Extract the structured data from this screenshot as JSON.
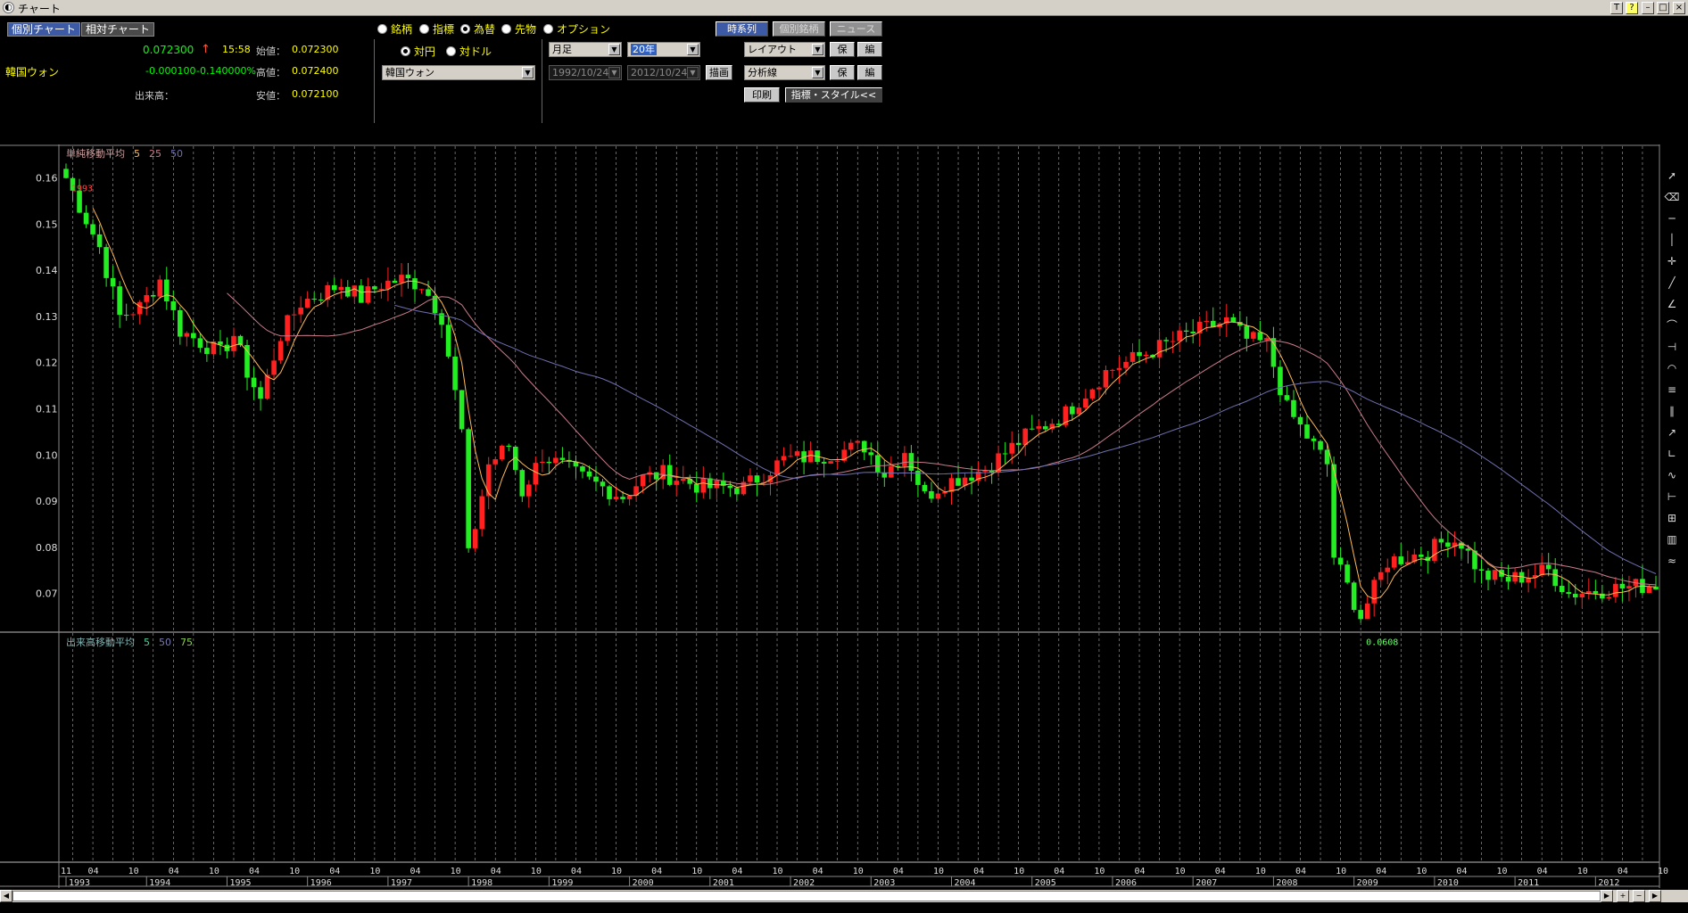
{
  "window": {
    "title": "チャート",
    "buttons": [
      "T",
      "?",
      "–",
      "□",
      "×"
    ]
  },
  "tabs": [
    {
      "label": "個別チャート",
      "active": true
    },
    {
      "label": "相対チャート",
      "active": false
    }
  ],
  "quote": {
    "name": "韓国ウォン",
    "price": "0.072300",
    "arrow": "↑",
    "time": "15:58",
    "change": "-0.000100",
    "change_pct": "-0.140000%",
    "volume_label": "出来高：",
    "open_label": "始値：",
    "open": "0.072300",
    "high_label": "高値：",
    "high": "0.072400",
    "low_label": "安値：",
    "low": "0.072100"
  },
  "instrument_type": {
    "options": [
      "銘柄",
      "指標",
      "為替",
      "先物",
      "オプション"
    ],
    "selected": "為替"
  },
  "base": {
    "options": [
      "対円",
      "対ドル"
    ],
    "selected": "対円"
  },
  "currency_select": "韓国ウォン",
  "period": {
    "interval": "月足",
    "span": "20年",
    "from": "1992/10/24",
    "to": "2012/10/24",
    "draw_label": "描画"
  },
  "buttons": {
    "timeseries": "時系列",
    "stock_info": "個別銘柄",
    "news": "ニュース",
    "layout": "レイアウト",
    "save": "保存",
    "edit": "編集",
    "analysis": "分析線",
    "print": "印刷",
    "indicator_style": "指標・スタイル<<"
  },
  "chart_data": {
    "type": "candlestick",
    "x_unit": "month",
    "start": "1993-01",
    "ylim": [
      0.063,
      0.163
    ],
    "yticks": [
      "0.16",
      "0.15",
      "0.14",
      "0.13",
      "0.12",
      "0.11",
      "0.10",
      "0.09",
      "0.08",
      "0.07"
    ],
    "x_year_labels": [
      "1993",
      "1994",
      "1995",
      "1996",
      "1997",
      "1998",
      "1999",
      "2000",
      "2001",
      "2002",
      "2003",
      "2004",
      "2005",
      "2006",
      "2007",
      "2008",
      "2009",
      "2010",
      "2011",
      "2012"
    ],
    "x_month_labels": [
      "11",
      "04",
      "10"
    ],
    "price_legend": {
      "title": "単純移動平均",
      "periods": [
        "5",
        "25",
        "50"
      ],
      "colors": [
        "#ffbb55",
        "#c97a8a",
        "#6f6fb0"
      ]
    },
    "volume_legend": {
      "title": "出来高移動平均",
      "periods": [
        "5",
        "50",
        "75"
      ],
      "colors": [
        "#55cc99",
        "#7a7ab0",
        "#88cc55"
      ]
    },
    "annotations": [
      {
        "text": "1993",
        "x": "1993-01",
        "y": 0.159,
        "color": "#ff4444"
      },
      {
        "text": "0.0608",
        "x": "2009-02",
        "y": 0.0608,
        "color": "#66ff66"
      }
    ],
    "anchors": [
      [
        "1993-01",
        0.16
      ],
      [
        "1993-06",
        0.145
      ],
      [
        "1993-09",
        0.13
      ],
      [
        "1993-12",
        0.132
      ],
      [
        "1994-03",
        0.138
      ],
      [
        "1994-06",
        0.127
      ],
      [
        "1994-12",
        0.122
      ],
      [
        "1995-02",
        0.126
      ],
      [
        "1995-04",
        0.118
      ],
      [
        "1995-06",
        0.112
      ],
      [
        "1995-09",
        0.126
      ],
      [
        "1995-12",
        0.133
      ],
      [
        "1996-03",
        0.135
      ],
      [
        "1996-06",
        0.137
      ],
      [
        "1996-09",
        0.134
      ],
      [
        "1996-12",
        0.137
      ],
      [
        "1997-03",
        0.138
      ],
      [
        "1997-06",
        0.137
      ],
      [
        "1997-09",
        0.13
      ],
      [
        "1997-12",
        0.105
      ],
      [
        "1998-01",
        0.078
      ],
      [
        "1998-04",
        0.098
      ],
      [
        "1998-07",
        0.102
      ],
      [
        "1998-09",
        0.092
      ],
      [
        "1998-12",
        0.1
      ],
      [
        "1999-06",
        0.095
      ],
      [
        "1999-12",
        0.091
      ],
      [
        "2000-03",
        0.095
      ],
      [
        "2000-06",
        0.096
      ],
      [
        "2000-12",
        0.093
      ],
      [
        "2001-06",
        0.093
      ],
      [
        "2001-12",
        0.099
      ],
      [
        "2002-06",
        0.1
      ],
      [
        "2002-12",
        0.102
      ],
      [
        "2003-03",
        0.096
      ],
      [
        "2003-06",
        0.101
      ],
      [
        "2003-09",
        0.091
      ],
      [
        "2003-12",
        0.094
      ],
      [
        "2004-06",
        0.097
      ],
      [
        "2004-12",
        0.104
      ],
      [
        "2005-06",
        0.109
      ],
      [
        "2005-12",
        0.118
      ],
      [
        "2006-06",
        0.122
      ],
      [
        "2006-12",
        0.126
      ],
      [
        "2007-06",
        0.129
      ],
      [
        "2007-09",
        0.125
      ],
      [
        "2007-12",
        0.124
      ],
      [
        "2008-03",
        0.11
      ],
      [
        "2008-06",
        0.104
      ],
      [
        "2008-09",
        0.098
      ],
      [
        "2008-10",
        0.078
      ],
      [
        "2009-02",
        0.065
      ],
      [
        "2009-06",
        0.077
      ],
      [
        "2009-12",
        0.079
      ],
      [
        "2010-03",
        0.082
      ],
      [
        "2010-05",
        0.081
      ],
      [
        "2010-08",
        0.074
      ],
      [
        "2010-12",
        0.073
      ],
      [
        "2011-06",
        0.075
      ],
      [
        "2011-09",
        0.07
      ],
      [
        "2012-03",
        0.071
      ],
      [
        "2012-10",
        0.072
      ]
    ]
  },
  "sidebar_tools": [
    "cursor-icon",
    "eraser-icon",
    "hline-icon",
    "vline-icon",
    "crosshair-icon",
    "trendline-icon",
    "fib-fan-icon",
    "fib-arc-icon",
    "fib-time-icon",
    "fib-circle-icon",
    "channel-icon",
    "cycle-icon",
    "ray-icon",
    "fib-ext-icon",
    "regression-icon",
    "range-icon",
    "grid-icon",
    "bars-icon",
    "wave-icon"
  ]
}
